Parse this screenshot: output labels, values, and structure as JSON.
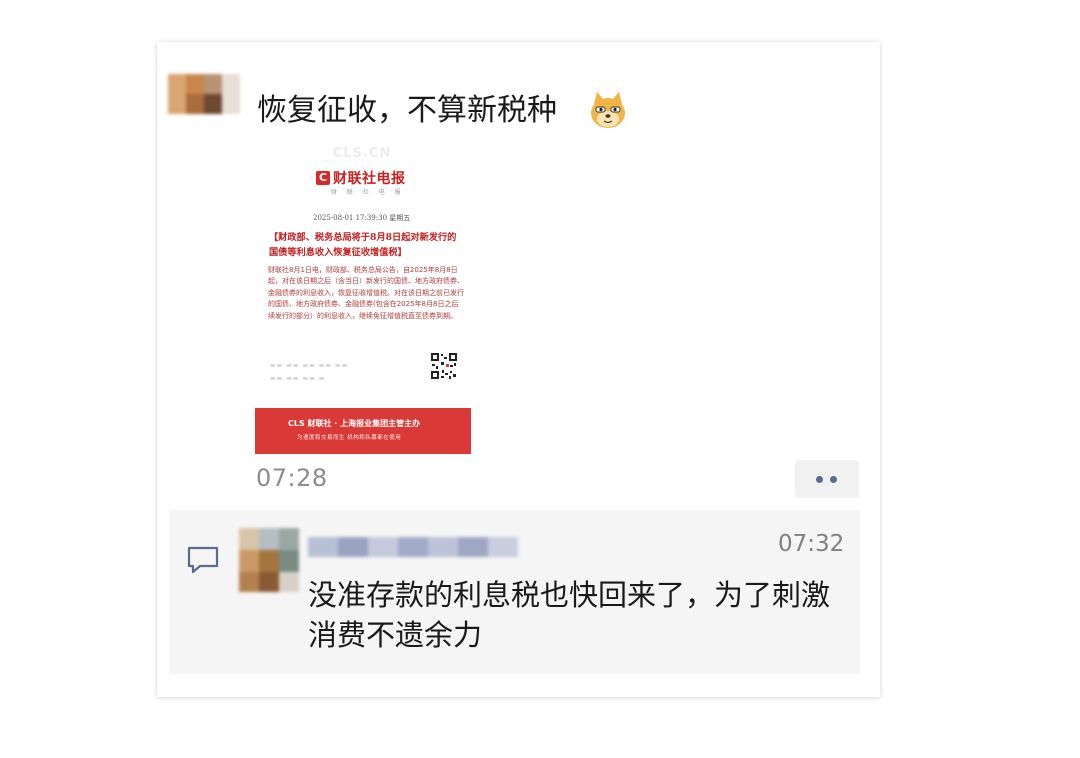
{
  "post": {
    "text": "恢复征收，不算新税种",
    "emoji": "doge-emoji",
    "time": "07:28"
  },
  "news_image": {
    "watermark": "CLS.CN",
    "brand": "财联社电报",
    "brand_sub": "财 联 社 电 报",
    "date": "2025-08-01 17:39:30 星期五",
    "headline": "【财政部、税务总局将于8月8日起对新发行的国债等利息收入恢复征收增值税】",
    "body": "财联社8月1日电，财政部、税务总局公告，自2025年8月8日起，对在该日期之后（含当日）新发行的国债、地方政府债券、金融债券的利息收入，恢复征收增值税。对在该日期之前已发行的国债、地方政府债券、金融债券(包含在2025年8月8日之后续发行的部分）的利息收入，继续免征增值税直至债券到期。",
    "footer_line1": "CLS 财联社 · 上海报业集团主管主办",
    "footer_line2": "为速度和交易而生 机构和私募都在使用"
  },
  "comment": {
    "time": "07:32",
    "text": "没准存款的利息税也快回来了，为了刺激消费不遗余力"
  },
  "colors": {
    "accent_red": "#d93a38",
    "link_blue": "#5a6b8c",
    "comment_bg": "#f5f5f5"
  }
}
